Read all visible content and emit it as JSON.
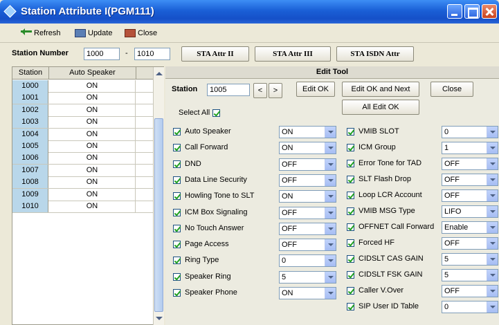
{
  "window": {
    "title": "Station Attribute I(PGM111)"
  },
  "toolbar": {
    "refresh": "Refresh",
    "update": "Update",
    "close": "Close"
  },
  "station_bar": {
    "label": "Station Number",
    "from": "1000",
    "dash": "-",
    "to": "1010",
    "tabs": [
      "STA Attr II",
      "STA Attr III",
      "STA ISDN Attr"
    ]
  },
  "grid": {
    "columns": [
      "Station",
      "Auto Speaker"
    ],
    "rows": [
      [
        "1000",
        "ON"
      ],
      [
        "1001",
        "ON"
      ],
      [
        "1002",
        "ON"
      ],
      [
        "1003",
        "ON"
      ],
      [
        "1004",
        "ON"
      ],
      [
        "1005",
        "ON"
      ],
      [
        "1006",
        "ON"
      ],
      [
        "1007",
        "ON"
      ],
      [
        "1008",
        "ON"
      ],
      [
        "1009",
        "ON"
      ],
      [
        "1010",
        "ON"
      ]
    ]
  },
  "edit_tool": {
    "header": "Edit Tool",
    "station_label": "Station",
    "station_value": "1005",
    "prev": "<",
    "next": ">",
    "edit_ok": "Edit OK",
    "edit_ok_next": "Edit OK and Next",
    "close": "Close",
    "all_edit_ok": "All Edit OK",
    "select_all": "Select All",
    "left_fields": [
      {
        "label": "Auto Speaker",
        "value": "ON"
      },
      {
        "label": "Call Forward",
        "value": "ON"
      },
      {
        "label": "DND",
        "value": "OFF"
      },
      {
        "label": "Data Line Security",
        "value": "OFF"
      },
      {
        "label": "Howling Tone to SLT",
        "value": "ON"
      },
      {
        "label": "ICM Box Signaling",
        "value": "OFF"
      },
      {
        "label": "No Touch Answer",
        "value": "OFF"
      },
      {
        "label": "Page Access",
        "value": "OFF"
      },
      {
        "label": "Ring Type",
        "value": "0"
      },
      {
        "label": "Speaker Ring",
        "value": "5"
      },
      {
        "label": "Speaker Phone",
        "value": "ON"
      }
    ],
    "right_fields": [
      {
        "label": "VMIB SLOT",
        "value": "0"
      },
      {
        "label": "ICM Group",
        "value": "1"
      },
      {
        "label": "Error Tone for TAD",
        "value": "OFF"
      },
      {
        "label": "SLT Flash Drop",
        "value": "OFF"
      },
      {
        "label": "Loop LCR Account",
        "value": "OFF"
      },
      {
        "label": "VMIB MSG Type",
        "value": "LIFO"
      },
      {
        "label": "OFFNET Call Forward",
        "value": "Enable"
      },
      {
        "label": "Forced HF",
        "value": "OFF"
      },
      {
        "label": "CIDSLT CAS GAIN",
        "value": "5"
      },
      {
        "label": "CIDSLT FSK GAIN",
        "value": "5"
      },
      {
        "label": "Caller V.Over",
        "value": "OFF"
      },
      {
        "label": "SIP User ID Table",
        "value": "0"
      }
    ]
  }
}
